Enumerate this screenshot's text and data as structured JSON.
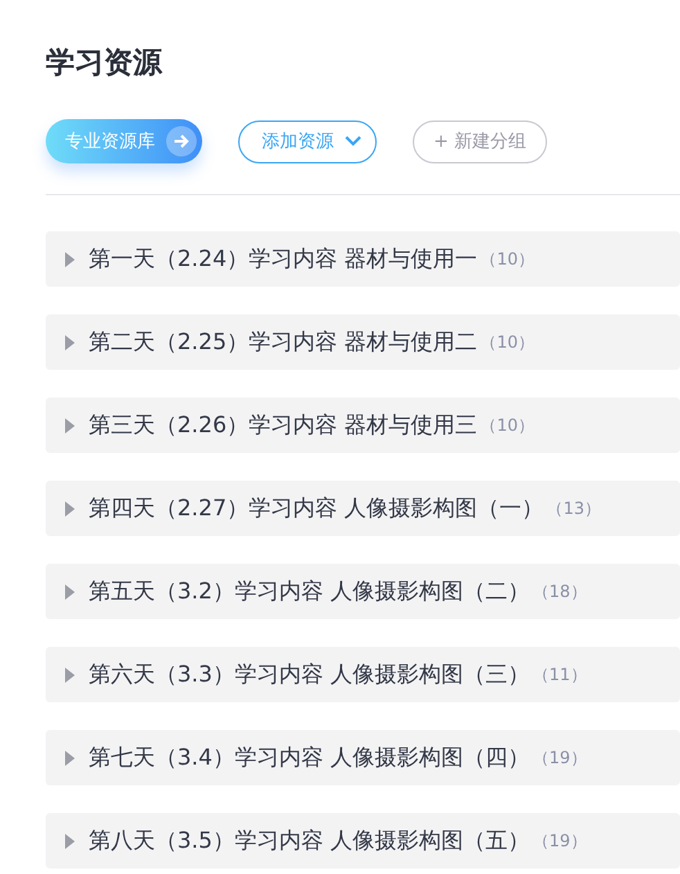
{
  "title": "学习资源",
  "toolbar": {
    "library_button": "专业资源库",
    "add_button": "添加资源",
    "new_group_button": "+ 新建分组"
  },
  "groups": [
    {
      "name": "第一天（2.24）学习内容 器材与使用一",
      "count": "（10）"
    },
    {
      "name": "第二天（2.25）学习内容 器材与使用二",
      "count": "（10）"
    },
    {
      "name": "第三天（2.26）学习内容 器材与使用三",
      "count": "（10）"
    },
    {
      "name": "第四天（2.27）学习内容 人像摄影构图（一）",
      "count": "（13）"
    },
    {
      "name": "第五天（3.2）学习内容 人像摄影构图（二）",
      "count": "（18）"
    },
    {
      "name": "第六天（3.3）学习内容 人像摄影构图（三）",
      "count": "（11）"
    },
    {
      "name": "第七天（3.4）学习内容 人像摄影构图（四）",
      "count": "（19）"
    },
    {
      "name": "第八天（3.5）学习内容 人像摄影构图（五）",
      "count": "（19）"
    }
  ]
}
